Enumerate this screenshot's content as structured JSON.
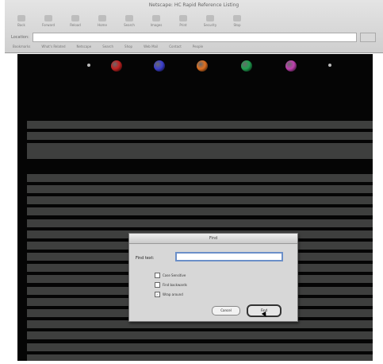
{
  "window": {
    "title": "Netscape: HC Rapid Reference Listing"
  },
  "toolbar": {
    "buttons": [
      "Back",
      "Forward",
      "Reload",
      "Home",
      "Search",
      "Images",
      "Print",
      "Security",
      "Stop"
    ]
  },
  "address": {
    "label": "Location:",
    "url": "",
    "go_label": ""
  },
  "bookmarks": [
    "Bookmarks",
    "What's Related",
    "Netscape",
    "Search",
    "Shop",
    "Web Mail",
    "Contact",
    "People"
  ],
  "site_nav": {
    "items": [
      {
        "label": "",
        "color": "#c22020"
      },
      {
        "label": "",
        "color": "#3c3fd0"
      },
      {
        "label": "",
        "color": "#e07020"
      },
      {
        "label": "",
        "color": "#1fa050"
      },
      {
        "label": "",
        "color": "#c040b0"
      }
    ]
  },
  "page_title": "",
  "page_subtitle": "",
  "table": {
    "columns": [
      "",
      "",
      "",
      ""
    ],
    "rows": [
      {
        "id": "",
        "col1": "",
        "col2": "",
        "col3": "",
        "style": ""
      },
      {
        "id": "",
        "col1": "",
        "col2": "",
        "col3": "",
        "style": ""
      },
      {
        "id": "",
        "col1": "",
        "col1b": "",
        "col2": "",
        "col3": "",
        "style": "tall"
      },
      {
        "id": "",
        "col1": "",
        "col2": "",
        "col3": "",
        "style": "blank"
      },
      {
        "id": "",
        "col1": "",
        "col2": "",
        "col3": "",
        "style": ""
      },
      {
        "id": "",
        "col1": "",
        "col2": "",
        "col3": "",
        "style": ""
      },
      {
        "id": "",
        "col1": "",
        "col2": "",
        "col3": "",
        "style": ""
      },
      {
        "id": "",
        "col1": "",
        "col2": "",
        "col3": "",
        "style": ""
      },
      {
        "id": "",
        "col1": "",
        "col2": "",
        "col3": "",
        "style": ""
      },
      {
        "id": "",
        "col1": "",
        "col2": "",
        "col3": "",
        "style": ""
      },
      {
        "id": "",
        "col1": "",
        "col2": "",
        "col3": "",
        "style": ""
      },
      {
        "id": "",
        "col1": "",
        "col2": "",
        "col3": "",
        "style": ""
      },
      {
        "id": "",
        "col1": "",
        "col2": "",
        "col3": "",
        "style": ""
      },
      {
        "id": "",
        "col1": "",
        "col2": "",
        "col3": "",
        "style": ""
      },
      {
        "id": "",
        "col1": "",
        "col2": "",
        "col3": "",
        "style": ""
      },
      {
        "id": "",
        "col1": "",
        "col2": "",
        "col3": "",
        "style": ""
      },
      {
        "id": "",
        "col1": "",
        "col2": "",
        "col3": "",
        "style": ""
      },
      {
        "id": "",
        "col1": "",
        "col2": "",
        "col3": "",
        "style": ""
      },
      {
        "id": "",
        "col1": "",
        "col2": "",
        "col3": "",
        "style": ""
      },
      {
        "id": "",
        "col1": "",
        "col2": "",
        "col3": "",
        "style": ""
      },
      {
        "id": "",
        "col1": "",
        "col2": "",
        "col3": "",
        "style": ""
      }
    ]
  },
  "find_dialog": {
    "title": "Find",
    "search_label": "Find text:",
    "search_value": "",
    "options": [
      {
        "label": "Case Sensitive",
        "checked": false
      },
      {
        "label": "Find backwards",
        "checked": false
      },
      {
        "label": "Wrap around",
        "checked": true
      }
    ],
    "cancel_label": "Cancel",
    "find_label": "Find"
  },
  "colors": {
    "page_bg": "#050505",
    "row_bg": "#3e3f3e",
    "header_text": "#3a6bd8",
    "id_text": "#e08a7a"
  }
}
